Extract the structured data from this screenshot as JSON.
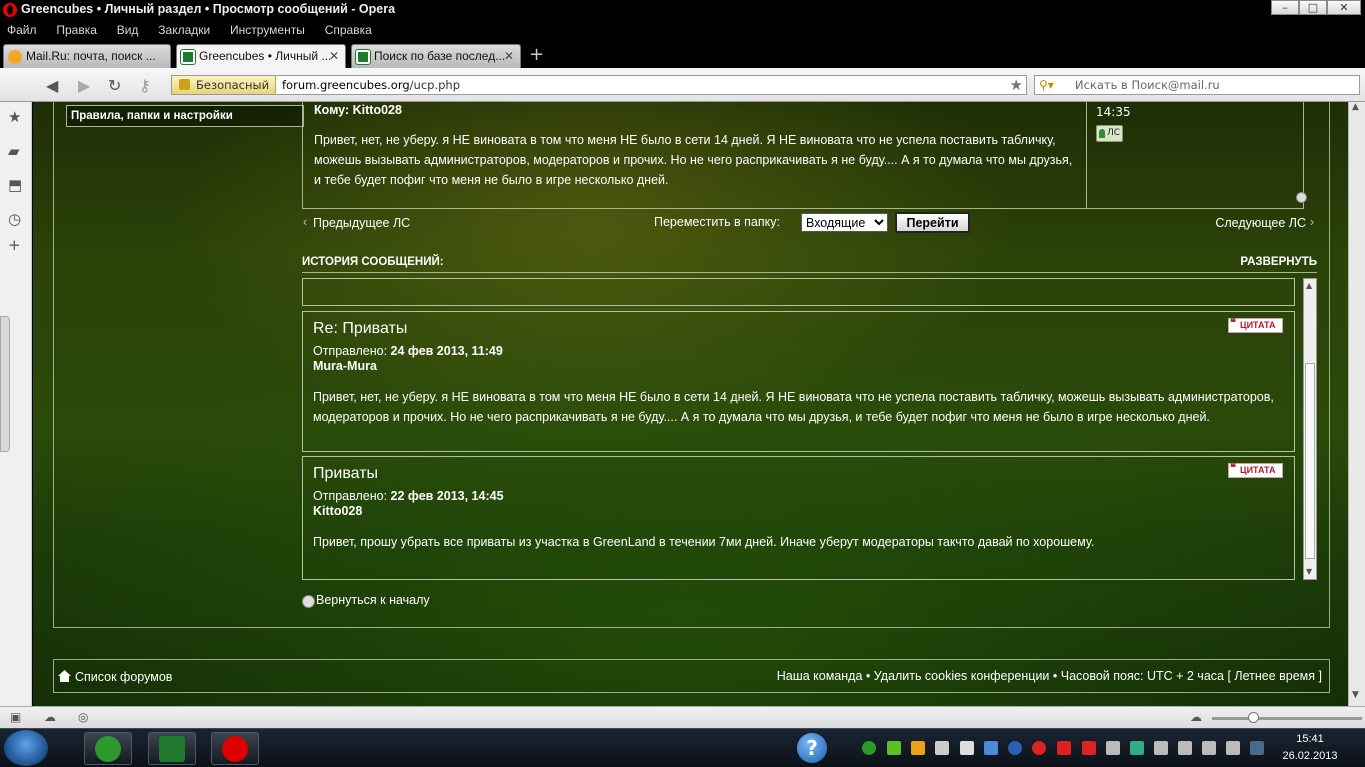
{
  "window": {
    "title": "Greencubes • Личный раздел • Просмотр сообщений - Opera"
  },
  "menu": [
    "Файл",
    "Правка",
    "Вид",
    "Закладки",
    "Инструменты",
    "Справка"
  ],
  "tabs": [
    {
      "label": "Mail.Ru: почта, поиск ...",
      "icon": "mailru-icon"
    },
    {
      "label": "Greencubes • Личный ...",
      "icon": "greencubes-icon"
    },
    {
      "label": "Поиск по базе послед...",
      "icon": "greencubes-icon"
    }
  ],
  "address": {
    "secure_label": "Безопасный",
    "url_domain": "forum.greencubes.org",
    "url_path": "/ucp.php",
    "search_placeholder": "Искать в Поиск@mail.ru"
  },
  "left_menu": {
    "section_label": "Правила, папки и настройки"
  },
  "message": {
    "to_label": "Кому:",
    "to_user": "Kitto028",
    "body": "Привет, нет, не уберу. я НЕ виновата в том что меня НЕ было в сети 14 дней. Я НЕ виновата что не успела поставить табличку, можешь вызывать администраторов, модераторов и прочих. Но не чего расприкачивать я не буду.... А я то думала что мы друзья, и тебе будет пофиг что меня не было в игре несколько дней.",
    "time": "14:35",
    "pm_button": "ЛС"
  },
  "nav": {
    "prev": "Предыдущее ЛС",
    "move_label": "Переместить в папку:",
    "folder": "Входящие",
    "go_button": "Перейти",
    "next": "Следующее ЛС"
  },
  "history": {
    "title": "ИСТОРИЯ СООБЩЕНИЙ:",
    "expand": "РАЗВЕРНУТЬ",
    "quote_label": "ЦИТАТА",
    "sent_label": "Отправлено:",
    "posts": [
      {
        "title": "Re: Приваты",
        "date": "24 фев 2013, 11:49",
        "author": "Mura-Mura",
        "body": "Привет, нет, не уберу. я НЕ виновата в том что меня НЕ было в сети 14 дней. Я НЕ виновата что не успела поставить табличку, можешь вызывать администраторов, модераторов и прочих. Но не чего расприкачивать я не буду.... А я то думала что мы друзья, и тебе будет пофиг что меня не было в игре несколько дней."
      },
      {
        "title": "Приваты",
        "date": "22 фев 2013, 14:45",
        "author": "Kitto028",
        "body": "Привет, прошу убрать все приваты из участка в GreenLand в течении 7ми дней. Иначе уберут модераторы такчто давай по хорошему."
      }
    ]
  },
  "back_to_top": "Вернуться к началу",
  "footer": {
    "forums_link": "Список форумов",
    "links": "Наша команда • Удалить cookies конференции • Часовой пояс: UTC + 2 часа [ Летнее время ]"
  },
  "taskbar": {
    "time": "15:41",
    "date": "26.02.2013"
  }
}
